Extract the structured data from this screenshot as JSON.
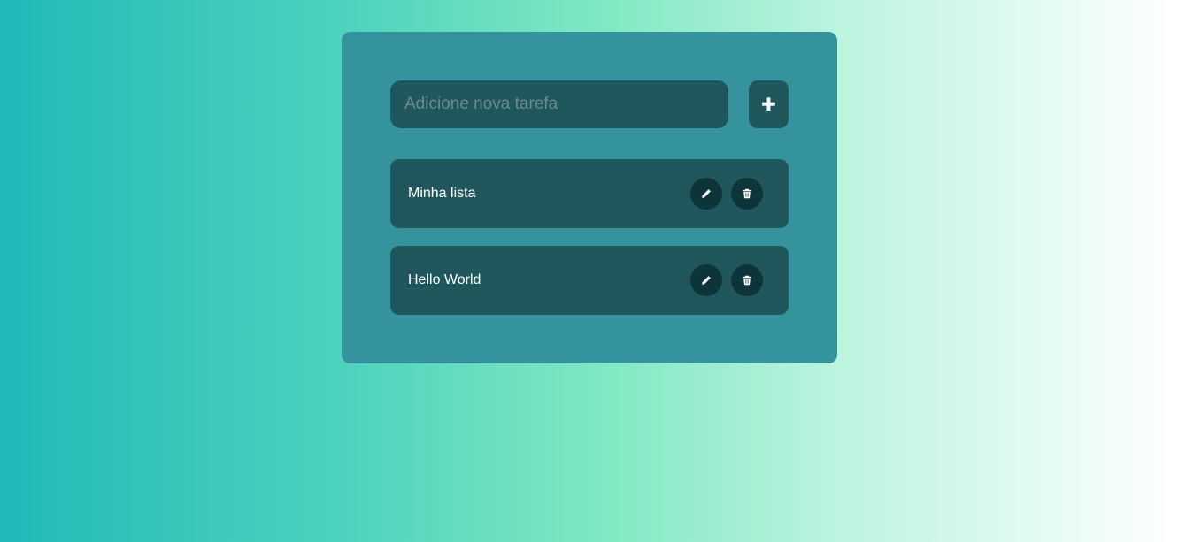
{
  "new_task": {
    "placeholder": "Adicione nova tarefa",
    "value": "",
    "add_icon": "plus-icon",
    "add_symbol": "✚"
  },
  "tasks": [
    {
      "label": "Minha lista",
      "edit_icon": "pencil-icon",
      "delete_icon": "trash-icon"
    },
    {
      "label": "Hello World",
      "edit_icon": "pencil-icon",
      "delete_icon": "trash-icon"
    }
  ],
  "colors": {
    "card": "#35939d",
    "item": "#1f575d",
    "icon_button": "#0c3439",
    "text": "#ffffff"
  }
}
